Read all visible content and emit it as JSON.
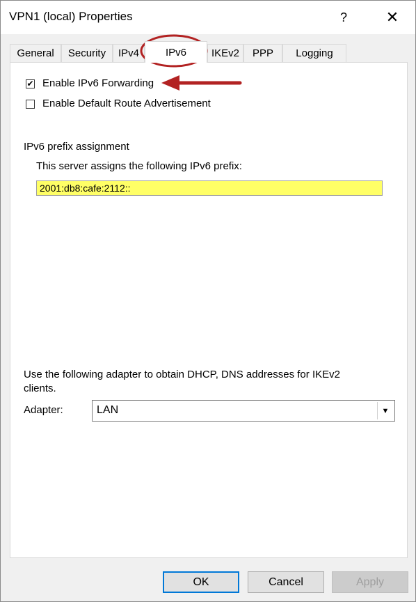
{
  "window": {
    "title": "VPN1 (local) Properties",
    "help_glyph": "?",
    "close_glyph": "✕"
  },
  "tabs": [
    {
      "label": "General",
      "active": false
    },
    {
      "label": "Security",
      "active": false
    },
    {
      "label": "IPv4",
      "active": false
    },
    {
      "label": "IPv6",
      "active": true
    },
    {
      "label": "IKEv2",
      "active": false
    },
    {
      "label": "PPP",
      "active": false
    },
    {
      "label": "Logging",
      "active": false
    }
  ],
  "ipv6": {
    "enable_forwarding": {
      "label": "Enable IPv6 Forwarding",
      "checked": true,
      "mark": "✔"
    },
    "default_route": {
      "label": "Enable Default Route Advertisement",
      "checked": false
    },
    "prefix_section_title": "IPv6 prefix assignment",
    "prefix_caption": "This server assigns the following  IPv6 prefix:",
    "prefix_value": "2001:db8:cafe:2112::",
    "adapter_note_line1": "Use the following adapter to obtain DHCP, DNS addresses for IKEv2",
    "adapter_note_line2": "clients.",
    "adapter_label": "Adapter:",
    "adapter_value": "LAN"
  },
  "buttons": {
    "ok": "OK",
    "cancel": "Cancel",
    "apply": "Apply"
  },
  "annotation_color": "#b22222"
}
